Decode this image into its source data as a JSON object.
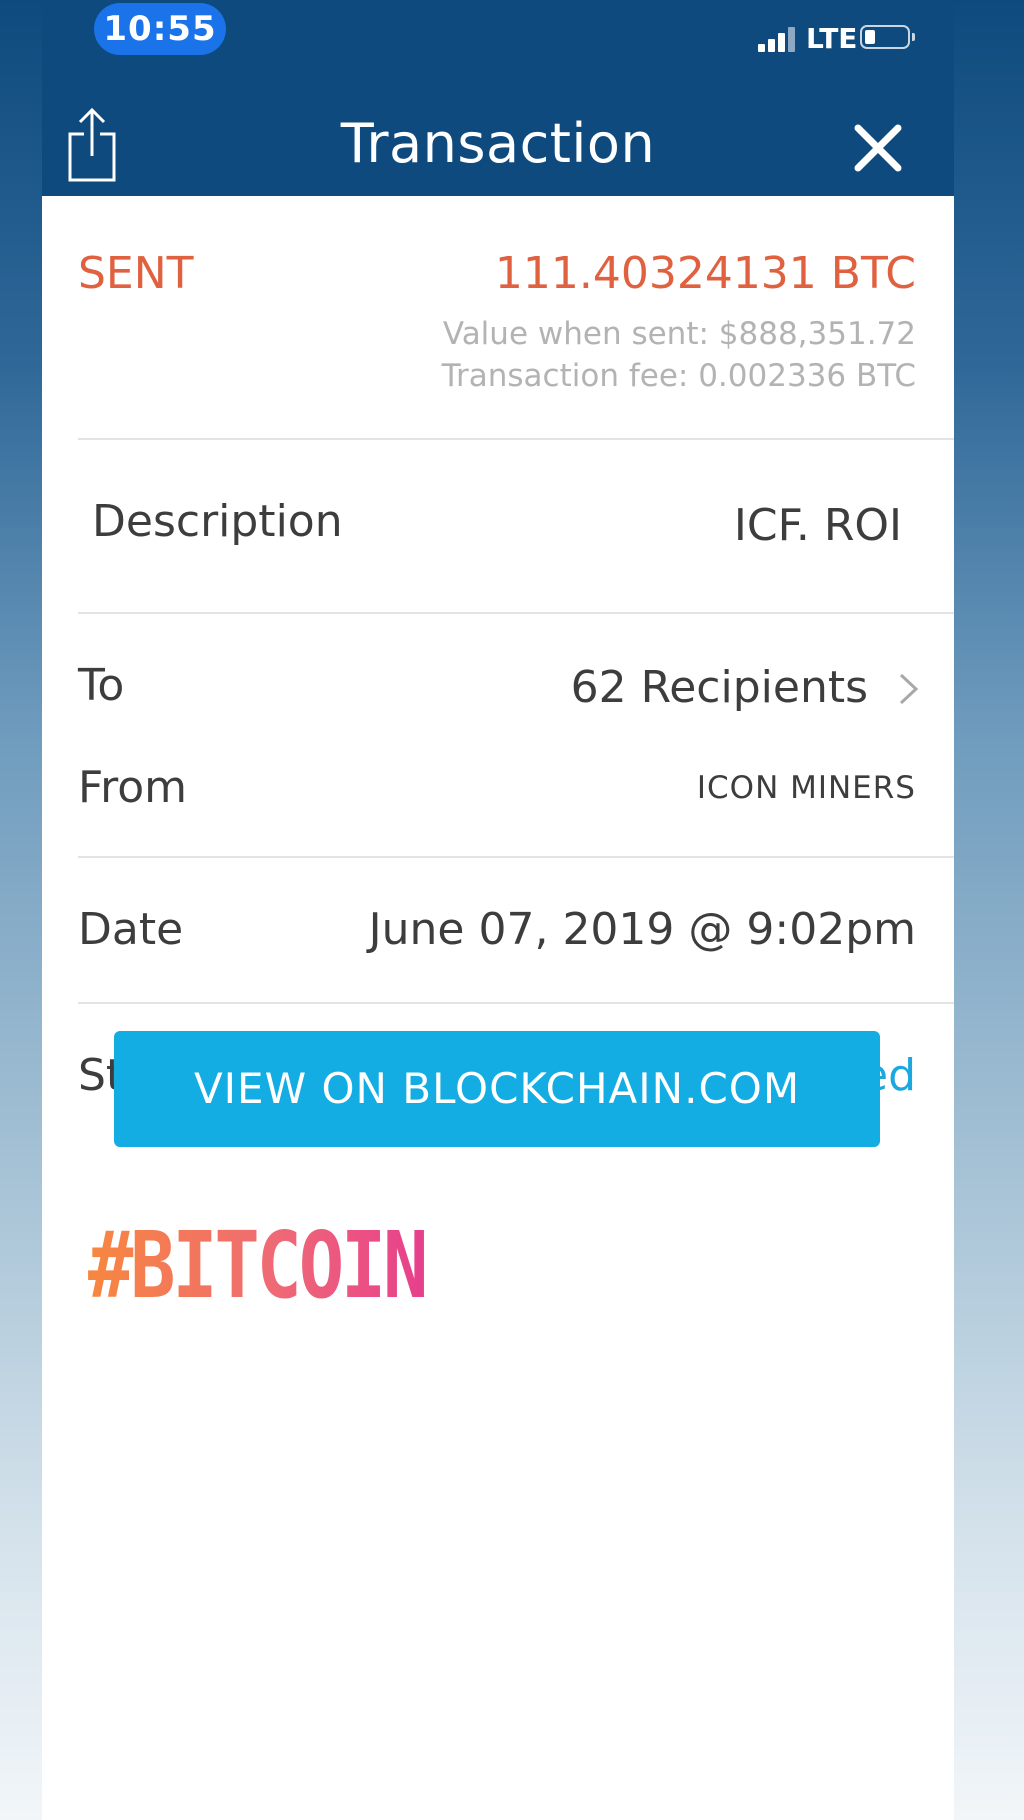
{
  "status_bar": {
    "time": "10:55",
    "network": "LTE"
  },
  "header": {
    "title": "Transaction"
  },
  "transaction": {
    "direction": "SENT",
    "amount": "111.40324131 BTC",
    "value_when_sent": "Value when sent: $888,351.72",
    "fee": "Transaction fee: 0.002336 BTC",
    "description_label": "Description",
    "description_value": "ICF. ROI",
    "to_label": "To",
    "to_value": "62 Recipients",
    "from_label": "From",
    "from_value": "ICON MINERS",
    "date_label": "Date",
    "date_value": "June 07, 2019 @ 9:02pm",
    "status_label": "Status",
    "status_value": "Confirmed"
  },
  "actions": {
    "view_button": "VIEW ON BLOCKCHAIN.COM"
  },
  "overlay": {
    "hashtag": "#BITCOIN"
  },
  "colors": {
    "header_bg": "#0f4a7e",
    "sent_red": "#e0613f",
    "confirmed_blue": "#1ba8e0",
    "button_blue": "#13ace3"
  },
  "icons": {
    "share": "share-icon",
    "close": "close-icon",
    "chevron": "chevron-right-icon",
    "signal": "signal-icon",
    "battery": "battery-icon"
  }
}
